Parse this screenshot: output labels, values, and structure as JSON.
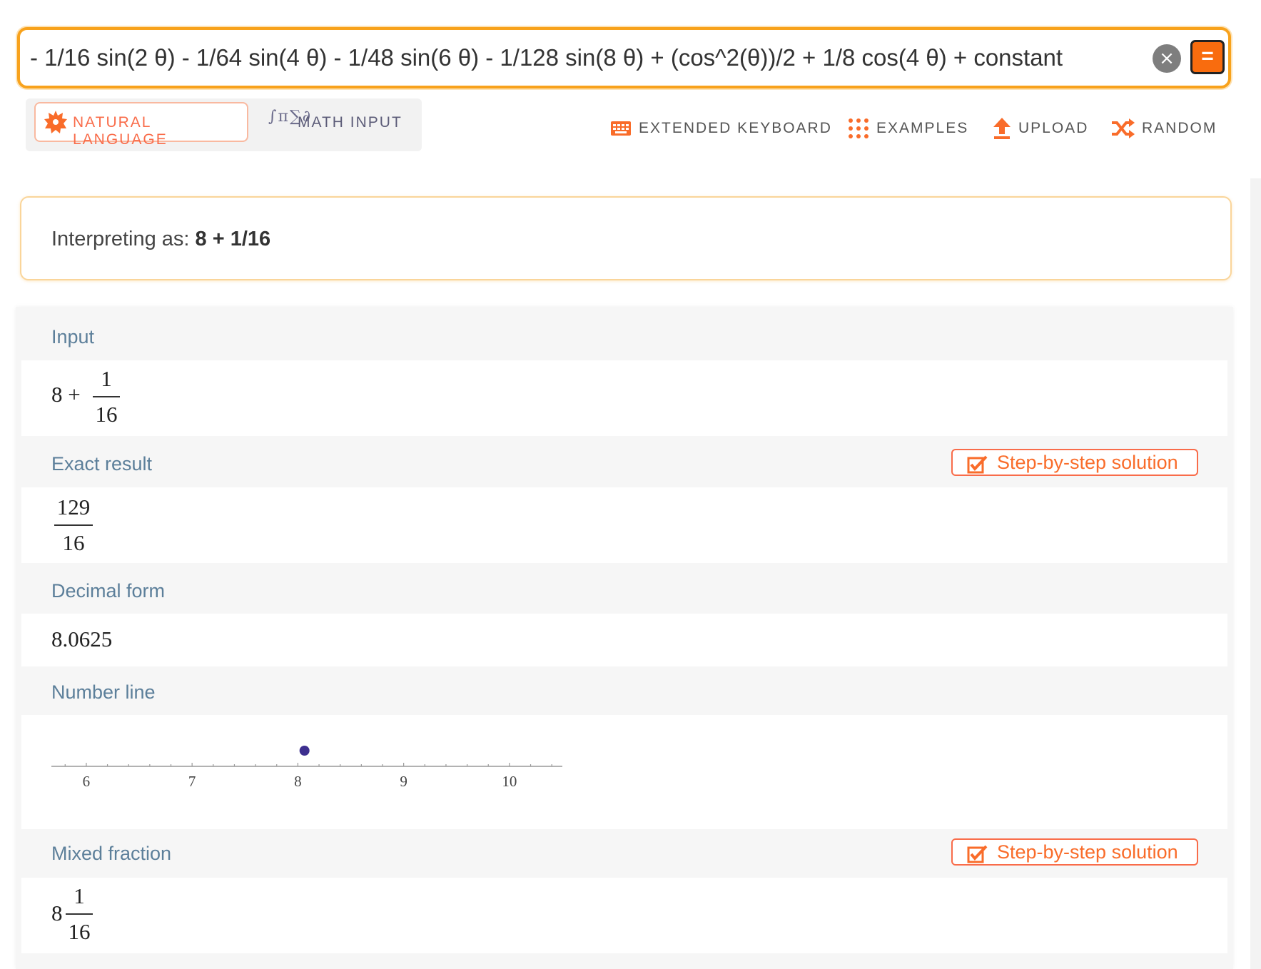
{
  "search": {
    "query": "- 1/16 sin(2 θ) - 1/64 sin(4 θ) - 1/48 sin(6 θ) - 1/128 sin(8 θ) + (cos^2(θ))/2 + 1/8 cos(4 θ) + constant",
    "clear_icon": "×",
    "compute_icon": "="
  },
  "modes": {
    "natural_language": "NATURAL LANGUAGE",
    "math_input": "MATH INPUT",
    "math_input_glyph": "∫π∑∂"
  },
  "toolbar": {
    "extended_keyboard": "EXTENDED KEYBOARD",
    "examples": "EXAMPLES",
    "upload": "UPLOAD",
    "random": "RANDOM"
  },
  "interpretation": {
    "prefix": "Interpreting as:",
    "value": "8 + 1/16"
  },
  "pods": {
    "input": {
      "title": "Input",
      "whole": "8 +",
      "numerator": "1",
      "denominator": "16"
    },
    "exact": {
      "title": "Exact result",
      "step_label": "Step-by-step solution",
      "numerator": "129",
      "denominator": "16"
    },
    "decimal": {
      "title": "Decimal form",
      "value": "8.0625"
    },
    "number_line": {
      "title": "Number line"
    },
    "mixed": {
      "title": "Mixed fraction",
      "step_label": "Step-by-step solution",
      "whole": "8",
      "numerator": "1",
      "denominator": "16"
    }
  },
  "chart_data": {
    "type": "scatter",
    "title": "",
    "xlabel": "",
    "ylabel": "",
    "xlim": [
      5.67,
      10.5
    ],
    "ticks": [
      "6",
      "7",
      "8",
      "9",
      "10"
    ],
    "minor_tick_step": 0.2,
    "series": [
      {
        "x": [
          8.0625
        ],
        "y": [
          0
        ]
      }
    ],
    "point_color": "#3d2f8f",
    "grid": false
  },
  "colors": {
    "accent_orange": "#f96c0e",
    "search_border": "#f8a21c",
    "pod_title": "#5c7f9a"
  }
}
